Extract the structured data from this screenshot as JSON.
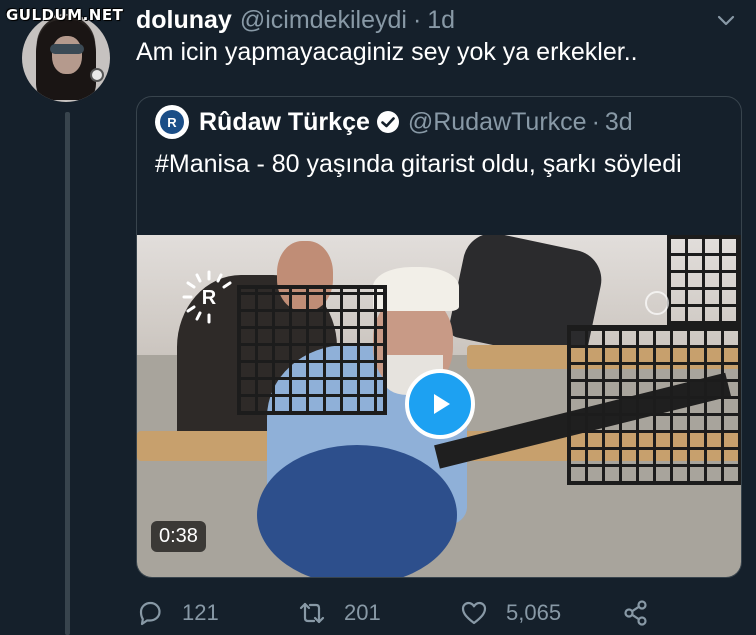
{
  "watermark": "GULDUM.NET",
  "tweet": {
    "display_name": "dolunay",
    "handle": "@icimdekileydi",
    "separator": "·",
    "time": "1d",
    "text": "Am icin yapmayacaginiz sey yok ya erkekler.."
  },
  "quoted": {
    "avatar_letter": "R",
    "display_name": "Rûdaw Türkçe",
    "handle": "@RudawTurkce",
    "separator": "·",
    "time": "3d",
    "text": "#Manisa - 80 yaşında gitarist oldu, şarkı söyledi",
    "video": {
      "duration": "0:38",
      "logo_letter": "R"
    }
  },
  "actions": {
    "replies": "121",
    "retweets": "201",
    "likes": "5,065"
  },
  "icons": {
    "chevron": "chevron-down-icon",
    "verified": "verified-badge-icon",
    "reply": "reply-icon",
    "retweet": "retweet-icon",
    "like": "heart-icon",
    "share": "share-icon",
    "play": "play-icon"
  },
  "colors": {
    "background": "#15202b",
    "secondary_text": "#8899a6",
    "border": "#38444d",
    "accent": "#1da1f2"
  }
}
